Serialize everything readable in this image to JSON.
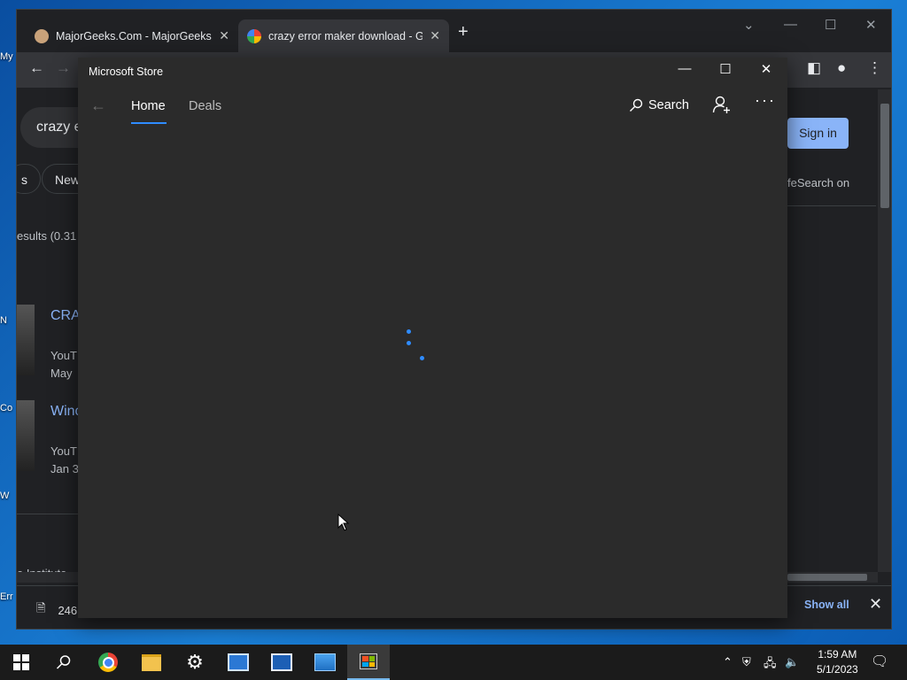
{
  "desktop": {
    "labels": [
      "My",
      "N",
      "Co",
      "W",
      "Err"
    ]
  },
  "chrome": {
    "tabs": [
      {
        "title": "MajorGeeks.Com - MajorGeeks",
        "close": "✕"
      },
      {
        "title": "crazy error maker download - Go",
        "close": "✕"
      }
    ],
    "new_tab": "+",
    "page": {
      "search_query": "crazy e",
      "chips": [
        "s",
        "New"
      ],
      "results_stats": "esults (0.31",
      "sign_in": "Sign in",
      "safesearch": "feSearch on",
      "result1": {
        "title": "CRA",
        "source": "YouT",
        "date": "May"
      },
      "result2": {
        "title": "Winc",
        "source": "YouT",
        "date": "Jan 3"
      },
      "footer_text": "e Institute"
    },
    "download": {
      "file": "246"
    },
    "show_all": "Show all"
  },
  "store": {
    "title": "Microsoft Store",
    "tabs": {
      "home": "Home",
      "deals": "Deals"
    },
    "search": "Search",
    "more": "···"
  },
  "taskbar": {
    "time": "1:59 AM",
    "date": "5/1/2023"
  },
  "colors": {
    "accent": "#2f8cff",
    "link": "#8ab4f8"
  }
}
